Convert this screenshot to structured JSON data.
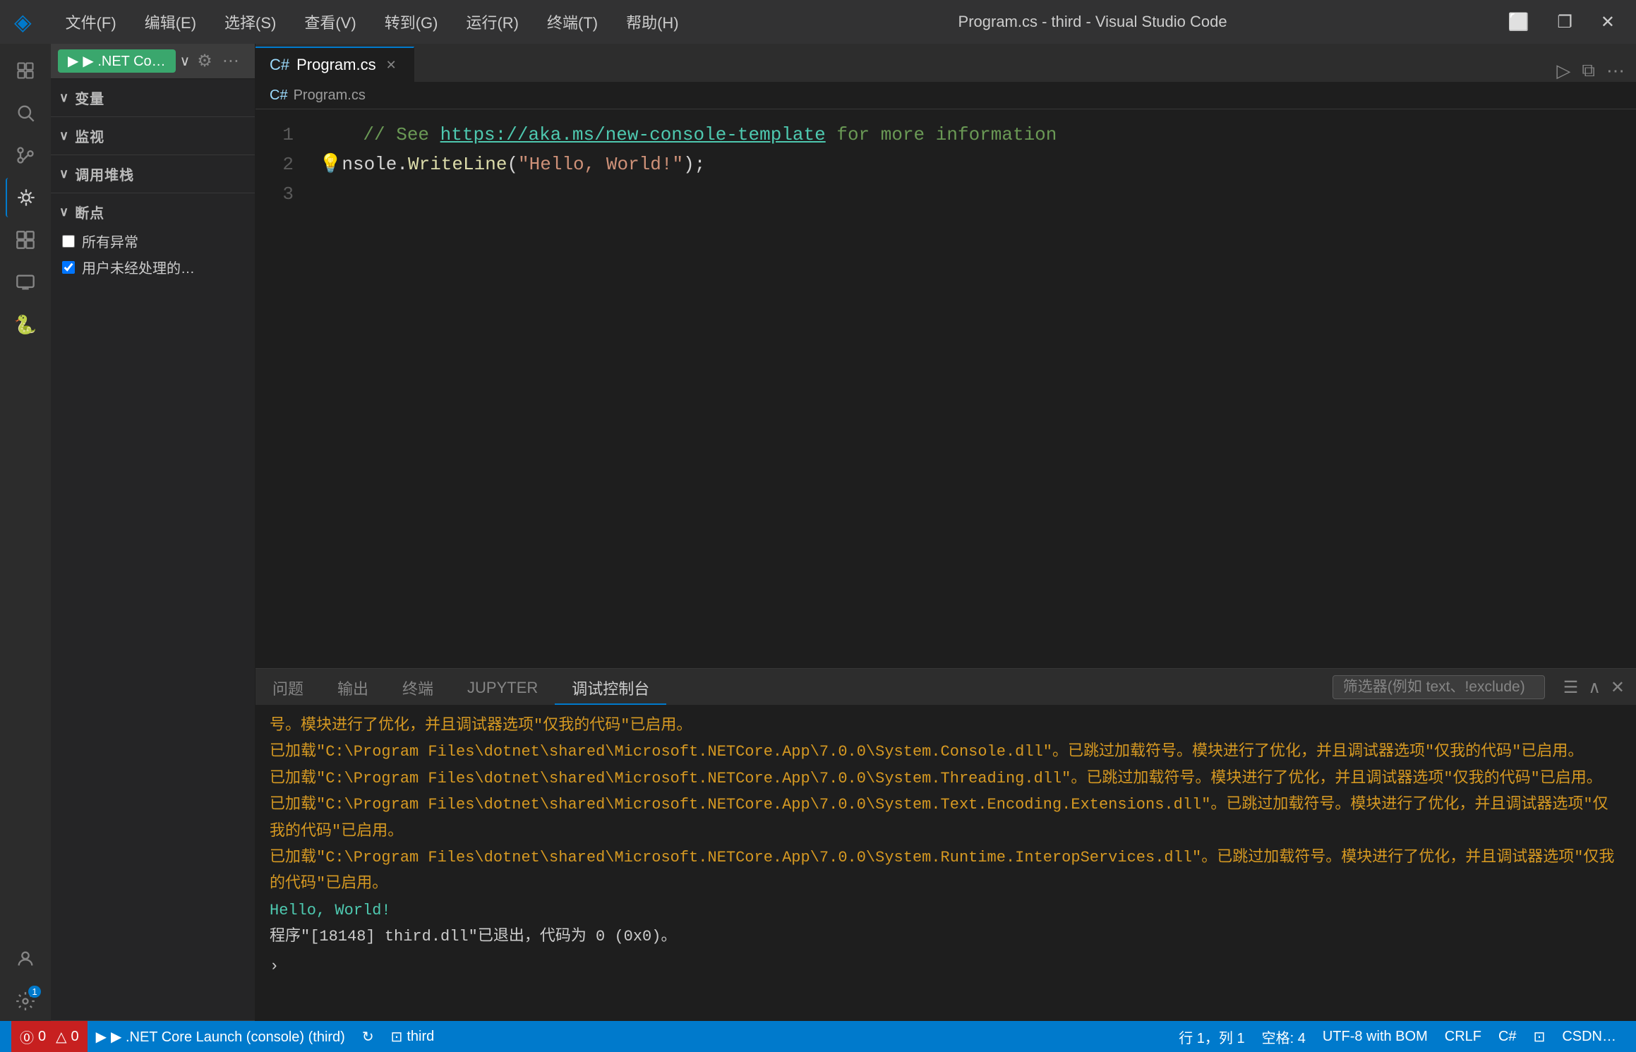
{
  "titlebar": {
    "logo": "◈",
    "menu": [
      "文件(F)",
      "编辑(E)",
      "选择(S)",
      "查看(V)",
      "转到(G)",
      "运行(R)",
      "终端(T)",
      "帮助(H)"
    ],
    "title": "Program.cs - third - Visual Studio Code",
    "controls": {
      "minimize": "─",
      "restore": "☐",
      "close": "✕"
    }
  },
  "activity_bar": {
    "icons": [
      {
        "name": "explorer",
        "symbol": "⧉",
        "active": false
      },
      {
        "name": "search",
        "symbol": "🔍",
        "active": false
      },
      {
        "name": "source-control",
        "symbol": "⎇",
        "active": false
      },
      {
        "name": "debug",
        "symbol": "⚡",
        "active": true
      },
      {
        "name": "extensions",
        "symbol": "⊞",
        "active": false
      },
      {
        "name": "terminal",
        "symbol": "⬜",
        "active": false
      },
      {
        "name": "python",
        "symbol": "🐍",
        "active": false
      }
    ],
    "bottom_icons": [
      {
        "name": "accounts",
        "symbol": "◉"
      },
      {
        "name": "settings",
        "symbol": "⚙",
        "badge": "1"
      }
    ]
  },
  "sidebar": {
    "debug_toolbar": {
      "run_label": "▶ .NET Co…",
      "dropdown_arrow": "∨",
      "icons": [
        "⚙",
        "⋯"
      ]
    },
    "sections": {
      "variables": {
        "header": "变量",
        "collapsed": false
      },
      "watch": {
        "header": "监视",
        "collapsed": false
      },
      "callstack": {
        "header": "调用堆栈",
        "collapsed": false
      },
      "breakpoints": {
        "header": "断点",
        "collapsed": false,
        "items": [
          {
            "label": "所有异常",
            "checked": false
          },
          {
            "label": "用户未经处理的…",
            "checked": true
          }
        ]
      }
    }
  },
  "editor": {
    "tabs": [
      {
        "label": "Program.cs",
        "active": true,
        "icon": "C#"
      }
    ],
    "breadcrumb": "Program.cs",
    "code_lines": [
      {
        "num": 1,
        "parts": [
          {
            "text": "    // See ",
            "class": "c-comment"
          },
          {
            "text": "https://aka.ms/new-console-template",
            "class": "c-link"
          },
          {
            "text": " for more ",
            "class": "c-comment"
          },
          {
            "text": "information",
            "class": "c-comment"
          }
        ]
      },
      {
        "num": 2,
        "parts": [
          {
            "text": "💡",
            "class": "c-lightbulb"
          },
          {
            "text": "nsole",
            "class": "c-normal"
          },
          {
            "text": ".",
            "class": "c-normal"
          },
          {
            "text": "WriteLine",
            "class": "c-method"
          },
          {
            "text": "(",
            "class": "c-normal"
          },
          {
            "text": "\"Hello, World!\"",
            "class": "c-string"
          },
          {
            "text": ");",
            "class": "c-normal"
          }
        ]
      },
      {
        "num": 3,
        "parts": []
      }
    ]
  },
  "panel": {
    "tabs": [
      {
        "label": "问题",
        "active": false
      },
      {
        "label": "输出",
        "active": false
      },
      {
        "label": "终端",
        "active": false
      },
      {
        "label": "JUPYTER",
        "active": false
      },
      {
        "label": "调试控制台",
        "active": true
      }
    ],
    "filter_placeholder": "筛选器(例如 text、!exclude)",
    "console_lines": [
      {
        "text": "号。模块进行了优化，并且调试器选项\"仅我的代码\"已启用。",
        "class": "console-line"
      },
      {
        "text": "已加载\"C:\\Program Files\\dotnet\\shared\\Microsoft.NETCore.App\\7.0.0\\System.Console.dll\"。已跳过加载符号。模块进行了优化，并且调试器选项\"仅我的代码\"已启用。",
        "class": "console-line"
      },
      {
        "text": "已加载\"C:\\Program Files\\dotnet\\shared\\Microsoft.NETCore.App\\7.0.0\\System.Threading.dll\"。已跳过加载符号。模块进行了优化，并且调试器选项\"仅我的代码\"已启用。",
        "class": "console-line"
      },
      {
        "text": "已加载\"C:\\Program Files\\dotnet\\shared\\Microsoft.NETCore.App\\7.0.0\\System.Text.Encoding.Extensions.dll\"。已跳过加载符号。模块进行了优化，并且调试器选项\"仅我的代码\"已启用。",
        "class": "console-line"
      },
      {
        "text": "已加载\"C:\\Program Files\\dotnet\\shared\\Microsoft.NETCore.App\\7.0.0\\System.Runtime.InteropServices.dll\"。已跳过加载符号。模块进行了优化，并且调试器选项\"仅我的代码\"已启用。",
        "class": "console-line"
      },
      {
        "text": "Hello, World!",
        "class": "console-line green"
      },
      {
        "text": "程序\"[18148] third.dll\"已退出，代码为 0 (0x0)。",
        "class": "console-line white"
      }
    ]
  },
  "statusbar": {
    "left_items": [
      {
        "name": "errors",
        "text": "⓪ 0  △ 0",
        "class": "error"
      },
      {
        "name": "debug-run",
        "text": "▶ .NET Core Launch (console) (third)"
      },
      {
        "name": "sync",
        "text": "↻"
      },
      {
        "name": "folder",
        "text": "⊡ third"
      }
    ],
    "right_items": [
      {
        "name": "line-col",
        "text": "行 1，列 1"
      },
      {
        "name": "spaces",
        "text": "空格: 4"
      },
      {
        "name": "encoding",
        "text": "UTF-8 with BOM"
      },
      {
        "name": "line-ending",
        "text": "CRLF"
      },
      {
        "name": "language",
        "text": "C#"
      },
      {
        "name": "remote",
        "text": "⊡"
      },
      {
        "name": "extra",
        "text": "CSDN…"
      }
    ]
  }
}
